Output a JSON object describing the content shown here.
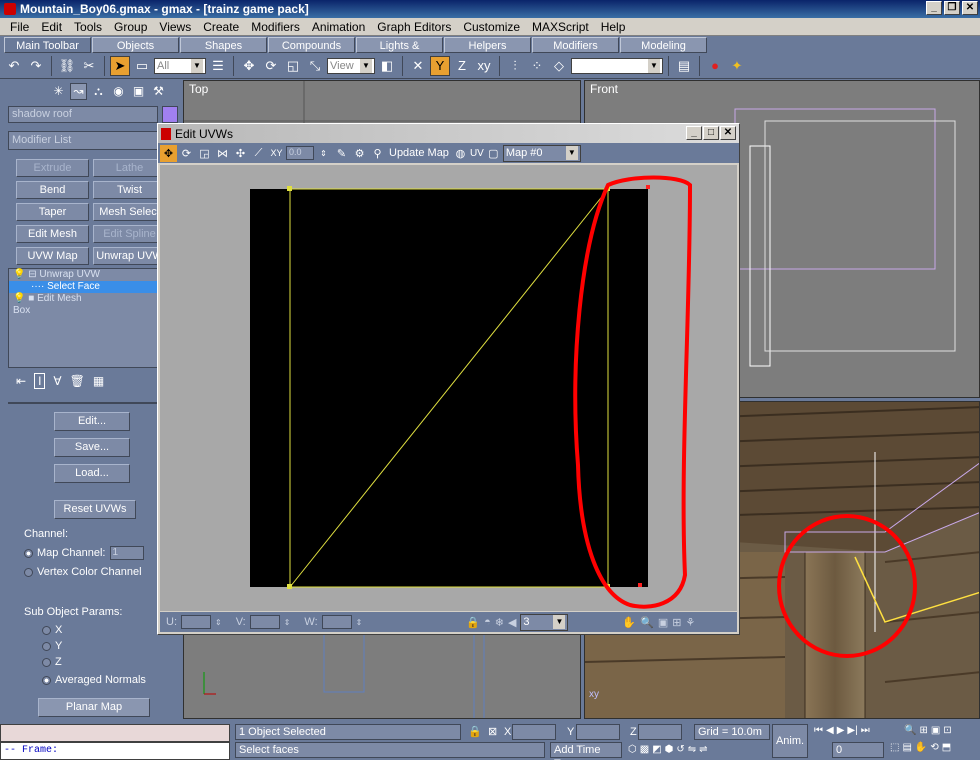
{
  "window": {
    "title": "Mountain_Boy06.gmax - gmax - [trainz game pack]"
  },
  "menu": [
    "File",
    "Edit",
    "Tools",
    "Group",
    "Views",
    "Create",
    "Modifiers",
    "Animation",
    "Graph Editors",
    "Customize",
    "MAXScript",
    "Help"
  ],
  "tabs": [
    "Main Toolbar",
    "Objects",
    "Shapes",
    "Compounds",
    "Lights & Cameras",
    "Helpers",
    "Modifiers",
    "Modeling"
  ],
  "toolbar": {
    "filter_value": "All",
    "ref_coord_value": "View"
  },
  "command_panel": {
    "object_name": "shadow roof",
    "modifier_list": "Modifier List",
    "modifier_buttons": [
      {
        "label": "Extrude",
        "disabled": true
      },
      {
        "label": "Lathe",
        "disabled": true
      },
      {
        "label": "Bend",
        "disabled": false
      },
      {
        "label": "Twist",
        "disabled": false
      },
      {
        "label": "Taper",
        "disabled": false
      },
      {
        "label": "Mesh Select",
        "disabled": false
      },
      {
        "label": "Edit Mesh",
        "disabled": false
      },
      {
        "label": "Edit Spline",
        "disabled": true
      },
      {
        "label": "UVW Map",
        "disabled": false
      },
      {
        "label": "Unwrap UVW",
        "disabled": false
      }
    ],
    "stack": [
      {
        "label": "Unwrap UVW",
        "selected": false
      },
      {
        "label": "Select Face",
        "selected": true
      },
      {
        "label": "Edit Mesh",
        "selected": false
      },
      {
        "label": "Box",
        "selected": false
      }
    ],
    "rollout": {
      "edit": "Edit...",
      "save": "Save...",
      "load": "Load...",
      "reset": "Reset UVWs",
      "channel_label": "Channel:",
      "map_channel": "Map Channel:",
      "map_channel_value": "1",
      "vertex_color": "Vertex Color Channel",
      "subobj_label": "Sub Object Params:",
      "axis_x": "X",
      "axis_y": "Y",
      "axis_z": "Z",
      "averaged": "Averaged Normals",
      "planar_map": "Planar Map"
    }
  },
  "viewports": {
    "top": "Top",
    "front": "Front"
  },
  "uvw_window": {
    "title": "Edit UVWs",
    "update_map": "Update Map",
    "uv": "UV",
    "map_select": "Map #0",
    "spinner_value": "0.0",
    "u_label": "U:",
    "v_label": "V:",
    "w_label": "W:",
    "zoom_value": "3"
  },
  "status": {
    "maxscript_line": "-- Frame:",
    "selection": "1 Object Selected",
    "prompt": "Select faces",
    "x_label": "X",
    "y_label": "Y",
    "z_label": "Z",
    "grid": "Grid = 10.0m",
    "add_time_tag": "Add Time Tag",
    "anim": "Anim.",
    "frame_value": "0"
  }
}
